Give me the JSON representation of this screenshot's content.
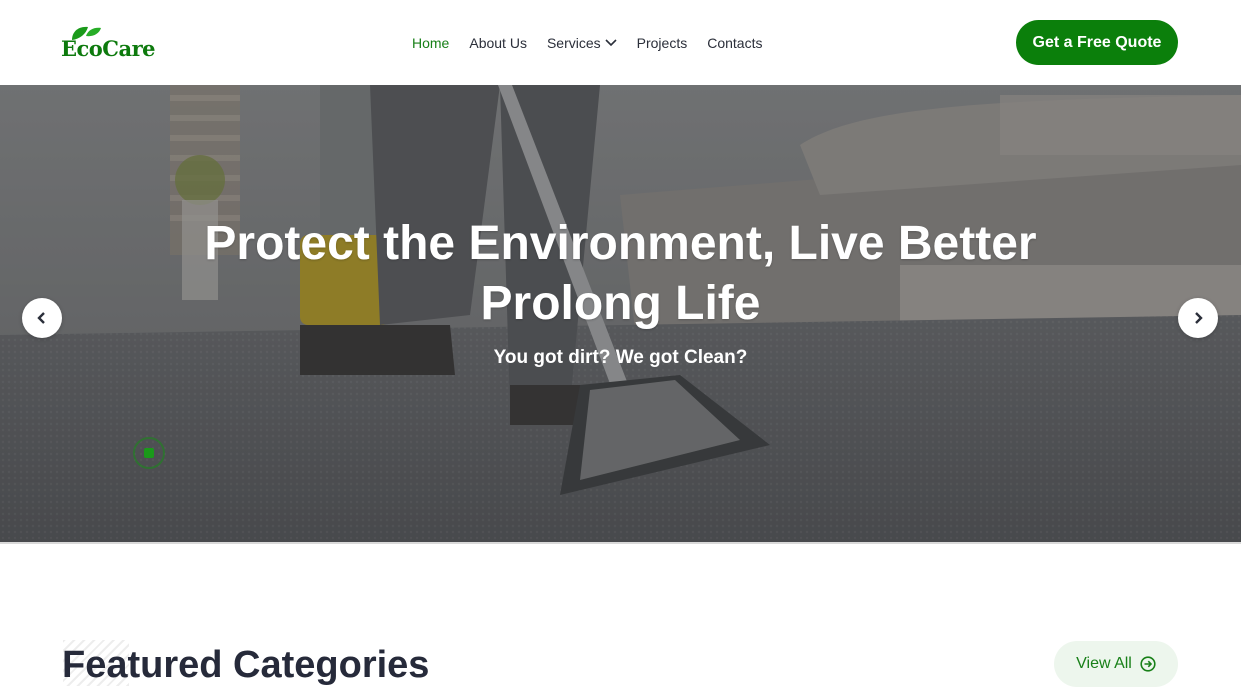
{
  "header": {
    "logo_text": "EcoCare",
    "nav": [
      {
        "label": "Home",
        "active": true
      },
      {
        "label": "About Us"
      },
      {
        "label": "Services",
        "has_dropdown": true
      },
      {
        "label": "Projects"
      },
      {
        "label": "Contacts"
      }
    ],
    "cta_label": "Get a Free Quote"
  },
  "hero": {
    "title_line1": "Protect the Environment, Live Better",
    "title_line2": "Prolong Life",
    "subtitle": "You got dirt? We got Clean?",
    "image_description_icon": "carpet-cleaning-photo"
  },
  "featured": {
    "title": "Featured Categories",
    "view_all_label": "View All"
  },
  "colors": {
    "brand_green": "#0b7f0b",
    "nav_active": "#188018",
    "heading_dark": "#262a3a"
  }
}
